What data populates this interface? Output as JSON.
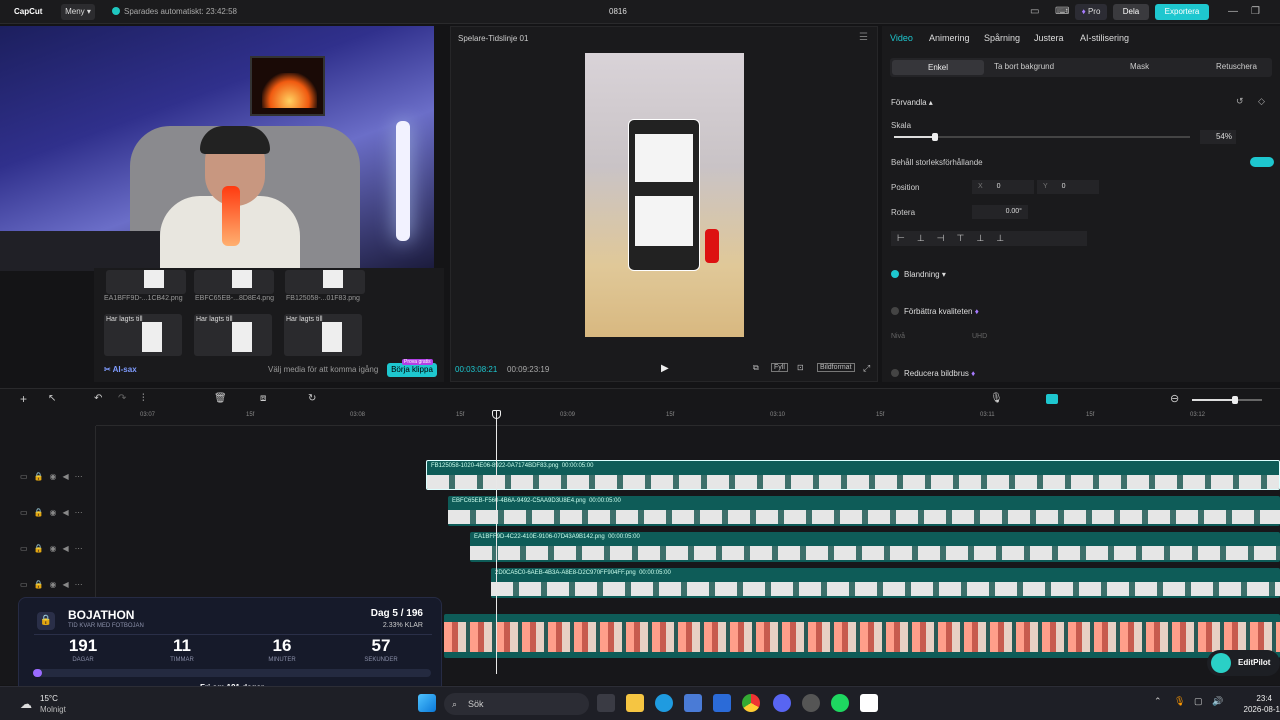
{
  "topbar": {
    "app_name": "CapCut",
    "menu_label": "Meny",
    "autosave_text": "Sparades automatiskt: 23:42:58",
    "project_title": "0816",
    "pro_label": "Pro",
    "share_label": "Dela",
    "export_label": "Exportera"
  },
  "media": {
    "items_row1": [
      "EA1BFF9D-...1CB42.png",
      "EBFC65EB-...8D8E4.png",
      "FB125058-...01F83.png"
    ],
    "added_label": "Har lagts till",
    "ai_label": "AI-sax",
    "hint": "Välj media för att komma igång",
    "start_button": "Börja klippa",
    "free_badge": "Prova gratis"
  },
  "player": {
    "title": "Spelare-Tidslinje 01",
    "current_time": "00:03:08:21",
    "total_time": "00:09:23:19",
    "fit_label": "Fyll",
    "ratio_label": "Bildformat"
  },
  "props": {
    "tabs": [
      "Video",
      "Animering",
      "Spårning",
      "Justera",
      "AI-stilisering"
    ],
    "subtabs": [
      "Enkel",
      "Ta bort bakgrund",
      "Mask",
      "Retuschera"
    ],
    "transform_section": "Förvandla",
    "scale_label": "Skala",
    "scale_value": "54%",
    "scale_fraction": 0.14,
    "keep_ratio_label": "Behåll storleksförhållande",
    "position_label": "Position",
    "pos_x_label": "X",
    "pos_x": "0",
    "pos_y_label": "Y",
    "pos_y": "0",
    "rotate_label": "Rotera",
    "rotate_value": "0.00°",
    "blend_label": "Blandning",
    "enhance_label": "Förbättra kvaliteten",
    "level_label": "Nivå",
    "level_value": "UHD",
    "denoise_label": "Reducera bildbrus"
  },
  "timeline": {
    "ruler": [
      "03:07",
      "15f",
      "03:08",
      "15f",
      "03:09",
      "15f",
      "03:10",
      "15f",
      "03:11",
      "15f",
      "03:12"
    ],
    "clips": [
      {
        "label": "FB125058-1020-4E06-8922-0A7174BDF83.png",
        "duration": "00:00:05:00"
      },
      {
        "label": "EBFC65EB-F560-4B6A-9492-C5AA9D3U8E4.png",
        "duration": "00:00:05:00"
      },
      {
        "label": "EA1BFF9D-4C22-410E-9106-07D43A9B142.png",
        "duration": "00:00:05:00"
      },
      {
        "label": "2D0CA5C0-6AEB-4B3A-A8E8-D2C970FF904FF.png",
        "duration": "00:00:05:00"
      }
    ]
  },
  "overlay": {
    "title": "BOJATHON",
    "subtitle": "TID KVAR MED FOTBOJAN",
    "day_label": "Dag 5 / 196",
    "progress_label": "2.33% KLAR",
    "progress_fraction": 0.0233,
    "units": [
      {
        "value": "191",
        "label": "DAGAR"
      },
      {
        "value": "11",
        "label": "TIMMAR"
      },
      {
        "value": "16",
        "label": "MINUTER"
      },
      {
        "value": "57",
        "label": "SEKUNDER"
      }
    ],
    "footer": "Fri om 191 dagar"
  },
  "taskbar": {
    "temp": "15°C",
    "weather": "Molnigt",
    "search": "Sök",
    "time": "23:4",
    "date": "2026-08-1"
  },
  "editpilot_label": "EditPilot"
}
